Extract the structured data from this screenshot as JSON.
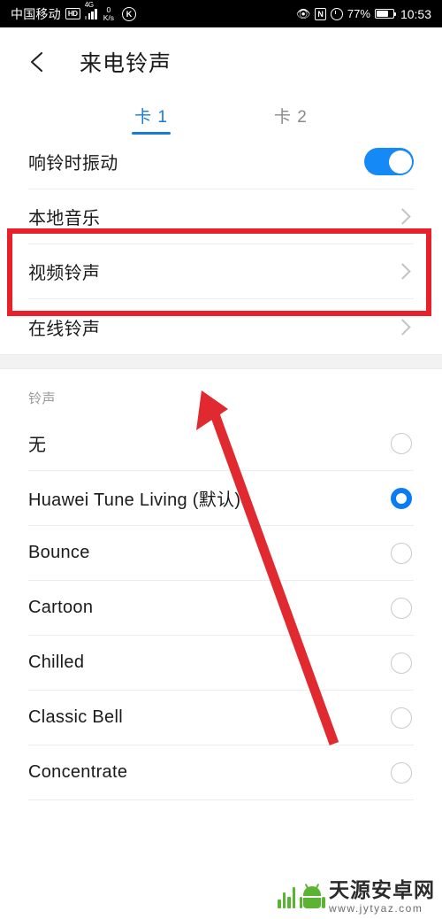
{
  "status_bar": {
    "carrier": "中国移动",
    "hd_badge": "HD",
    "network_type": "4G",
    "data_rate_value": "0",
    "data_rate_unit": "K/s",
    "circle_icon": "K",
    "eye_icon": "eye-protection-icon",
    "nfc_badge": "N",
    "alarm_icon": "alarm-clock-icon",
    "battery_percent": "77%",
    "time": "10:53"
  },
  "header": {
    "back_label": "back-arrow",
    "title": "来电铃声"
  },
  "tabs": [
    {
      "label": "卡 1",
      "active": true
    },
    {
      "label": "卡 2",
      "active": false
    }
  ],
  "settings": {
    "vibrate_label": "响铃时振动",
    "vibrate_on": true,
    "links": [
      {
        "label": "本地音乐",
        "highlighted": true
      },
      {
        "label": "视频铃声",
        "highlighted": false
      },
      {
        "label": "在线铃声",
        "highlighted": false
      }
    ]
  },
  "ringtone_section": {
    "header": "铃声",
    "items": [
      {
        "label": "无",
        "selected": false
      },
      {
        "label": "Huawei Tune Living (默认)",
        "selected": true
      },
      {
        "label": "Bounce",
        "selected": false
      },
      {
        "label": "Cartoon",
        "selected": false
      },
      {
        "label": "Chilled",
        "selected": false
      },
      {
        "label": "Classic Bell",
        "selected": false
      },
      {
        "label": "Concentrate",
        "selected": false
      }
    ]
  },
  "annotations": {
    "box_color": "#e8202a",
    "arrow_color": "#e02a2f",
    "box_target": "本地音乐",
    "arrow_target": "在线铃声"
  },
  "watermark": {
    "site_name": "天源安卓网",
    "url": "www.jytyaz.com",
    "logo": "android-robot-icon"
  },
  "colors": {
    "accent_blue": "#1a7ad9",
    "toggle_blue": "#1589f5",
    "radio_blue": "#0a7cf3",
    "annotation_red": "#e8202a",
    "watermark_green": "#5bb431"
  }
}
